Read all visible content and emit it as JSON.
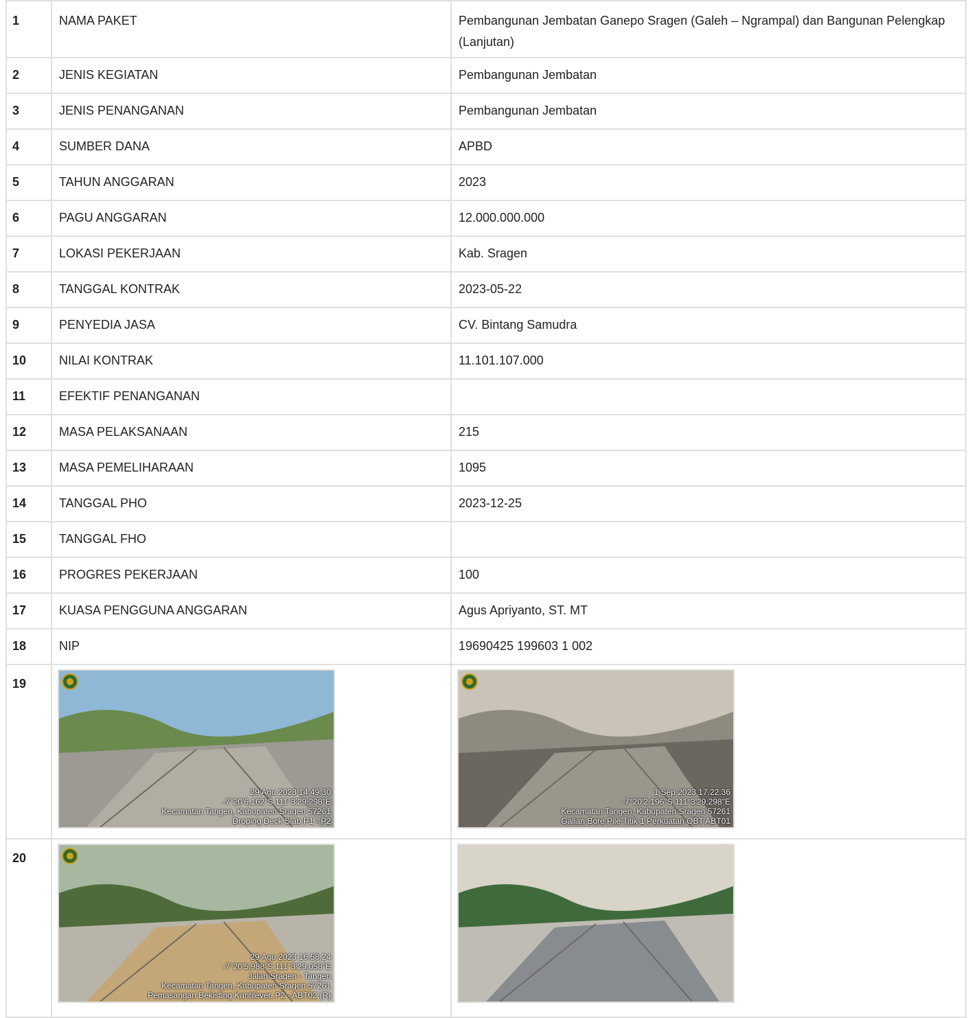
{
  "rows": [
    {
      "no": "1",
      "label": "NAMA PAKET",
      "value": "Pembangunan Jembatan Ganepo Sragen (Galeh – Ngrampal) dan Bangunan Pelengkap (Lanjutan)"
    },
    {
      "no": "2",
      "label": "JENIS KEGIATAN",
      "value": "Pembangunan Jembatan"
    },
    {
      "no": "3",
      "label": "JENIS PENANGANAN",
      "value": "Pembangunan Jembatan"
    },
    {
      "no": "4",
      "label": "SUMBER DANA",
      "value": "APBD"
    },
    {
      "no": "5",
      "label": "TAHUN ANGGARAN",
      "value": "2023"
    },
    {
      "no": "6",
      "label": "PAGU ANGGARAN",
      "value": "12.000.000.000"
    },
    {
      "no": "7",
      "label": "LOKASI PEKERJAAN",
      "value": "Kab. Sragen"
    },
    {
      "no": "8",
      "label": "TANGGAL KONTRAK",
      "value": "2023-05-22"
    },
    {
      "no": "9",
      "label": "PENYEDIA JASA",
      "value": "CV. Bintang Samudra"
    },
    {
      "no": "10",
      "label": "NILAI KONTRAK",
      "value": "11.101.107.000"
    },
    {
      "no": "11",
      "label": "EFEKTIF PENANGANAN",
      "value": ""
    },
    {
      "no": "12",
      "label": "MASA PELAKSANAAN",
      "value": "215"
    },
    {
      "no": "13",
      "label": "MASA PEMELIHARAAN",
      "value": "1095"
    },
    {
      "no": "14",
      "label": "TANGGAL PHO",
      "value": "2023-12-25"
    },
    {
      "no": "15",
      "label": "TANGGAL FHO",
      "value": ""
    },
    {
      "no": "16",
      "label": "PROGRES PEKERJAAN",
      "value": "100"
    },
    {
      "no": "17",
      "label": "KUASA PENGGUNA ANGGARAN",
      "value": "Agus Apriyanto, ST. MT"
    },
    {
      "no": "18",
      "label": "NIP",
      "value": "19690425 199603 1 002"
    }
  ],
  "photo_rows": [
    {
      "no": "19",
      "photos": [
        {
          "stamp": [
            "29 Agu 2023 14.49.30",
            "-7°20'6,162\"S 111°3'29,298\"E",
            "Kecamatan Tangen, Kabupaten Sragen 57261",
            "Droping Deck Slab P1 - P2"
          ]
        },
        {
          "stamp": [
            "1 Sep 2023 17.22.36",
            "-7°20'2,196\"S 111°3'29,298\"E",
            "Kecamatan Tangen, Kabupaten Sragen 57261",
            "Galian Bore Pile Titik 1 Perkuatan OBT ABT01"
          ]
        }
      ]
    },
    {
      "no": "20",
      "photos": [
        {
          "stamp": [
            "29 Agu 2023 16.58.24",
            "-7°20'5,988\"S 111°3'29,058\"E",
            "Jalan Sragen - Tangen",
            "Kecamatan Tangen, Kabupaten Sragen 57261",
            "Pemasangan Bekisting Kantilever, P2 - ABT02 (R)"
          ]
        },
        {
          "stamp": []
        }
      ]
    }
  ],
  "colors": {
    "border": "#e0e0e0",
    "text": "#222222"
  }
}
